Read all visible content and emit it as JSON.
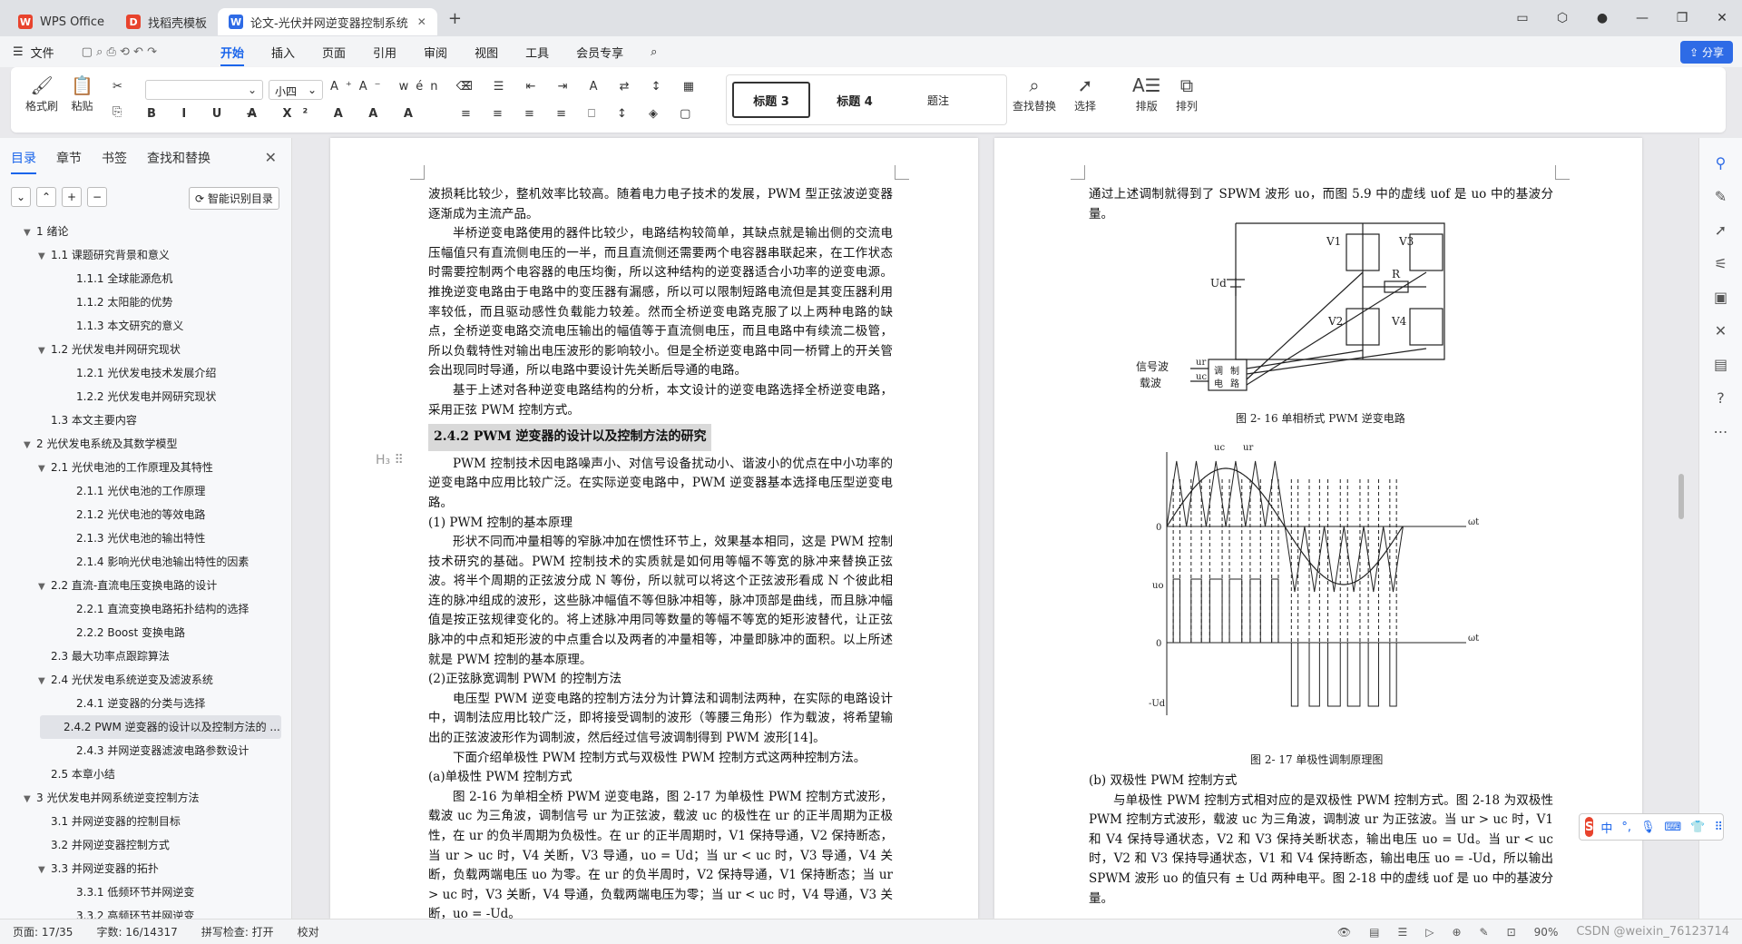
{
  "tabs": [
    {
      "label": "WPS Office",
      "icon": "wps-logo-icon",
      "color": "#e8432d"
    },
    {
      "label": "找稻壳模板",
      "icon": "docer-logo-icon",
      "color": "#e8432d"
    },
    {
      "label": "论文-光伏并网逆变器控制系统",
      "icon": "writer-logo-icon",
      "color": "#2e6be6"
    }
  ],
  "menu": {
    "file": "文件",
    "items": [
      "开始",
      "插入",
      "页面",
      "引用",
      "审阅",
      "视图",
      "工具",
      "会员专享"
    ],
    "active": "开始",
    "share": "分享"
  },
  "ribbon": {
    "format_painter": "格式刷",
    "paste": "粘贴",
    "font_name": "",
    "font_size": "小四",
    "styles": [
      "标题 3",
      "标题 4",
      "题注"
    ],
    "find_replace": "查找替换",
    "select": "选择",
    "typeset": "排版",
    "arrange": "排列"
  },
  "nav": {
    "tabs": [
      "目录",
      "章节",
      "书签",
      "查找和替换"
    ],
    "active_tab": "目录",
    "smart_btn": "智能识别目录",
    "toc": [
      {
        "label": "1  绪论",
        "level": 1,
        "arrow": "▼"
      },
      {
        "label": "1.1 课题研究背景和意义",
        "level": 2,
        "arrow": "▼"
      },
      {
        "label": "1.1.1 全球能源危机",
        "level": 3,
        "arrow": ""
      },
      {
        "label": "1.1.2 太阳能的优势",
        "level": 3,
        "arrow": ""
      },
      {
        "label": "1.1.3 本文研究的意义",
        "level": 3,
        "arrow": ""
      },
      {
        "label": "1.2 光伏发电并网研究现状",
        "level": 2,
        "arrow": "▼"
      },
      {
        "label": "1.2.1 光伏发电技术发展介绍",
        "level": 3,
        "arrow": ""
      },
      {
        "label": "1.2.2 光伏发电并网研究现状",
        "level": 3,
        "arrow": ""
      },
      {
        "label": "1.3 本文主要内容",
        "level": 2,
        "arrow": ""
      },
      {
        "label": "2  光伏发电系统及其数学模型",
        "level": 1,
        "arrow": "▼"
      },
      {
        "label": "2.1 光伏电池的工作原理及其特性",
        "level": 2,
        "arrow": "▼"
      },
      {
        "label": "2.1.1 光伏电池的工作原理",
        "level": 3,
        "arrow": ""
      },
      {
        "label": "2.1.2 光伏电池的等效电路",
        "level": 3,
        "arrow": ""
      },
      {
        "label": "2.1.3 光伏电池的输出特性",
        "level": 3,
        "arrow": ""
      },
      {
        "label": "2.1.4 影响光伏电池输出特性的因素",
        "level": 3,
        "arrow": ""
      },
      {
        "label": "2.2 直流-直流电压变换电路的设计",
        "level": 2,
        "arrow": "▼"
      },
      {
        "label": "2.2.1 直流变换电路拓扑结构的选择",
        "level": 3,
        "arrow": ""
      },
      {
        "label": "2.2.2 Boost 变换电路",
        "level": 3,
        "arrow": ""
      },
      {
        "label": "2.3  最大功率点跟踪算法",
        "level": 2,
        "arrow": ""
      },
      {
        "label": "2.4  光伏发电系统逆变及滤波系统",
        "level": 2,
        "arrow": "▼"
      },
      {
        "label": "2.4.1 逆变器的分类与选择",
        "level": 3,
        "arrow": ""
      },
      {
        "label": "2.4.2 PWM 逆变器的设计以及控制方法的 ...",
        "level": 3,
        "arrow": "",
        "selected": true
      },
      {
        "label": "2.4.3  并网逆变器滤波电路参数设计",
        "level": 3,
        "arrow": ""
      },
      {
        "label": "2.5 本章小结",
        "level": 2,
        "arrow": ""
      },
      {
        "label": "3  光伏发电并网系统逆变控制方法",
        "level": 1,
        "arrow": "▼"
      },
      {
        "label": "3.1  并网逆变器的控制目标",
        "level": 2,
        "arrow": ""
      },
      {
        "label": "3.2    并网逆变器控制方式",
        "level": 2,
        "arrow": ""
      },
      {
        "label": "3.3    并网逆变器的拓扑",
        "level": 2,
        "arrow": "▼"
      },
      {
        "label": "3.3.1    低频环节并网逆变",
        "level": 3,
        "arrow": ""
      },
      {
        "label": "3.3.2    高频环节并网逆变",
        "level": 3,
        "arrow": ""
      }
    ]
  },
  "page1": {
    "paragraphs": [
      {
        "text": "波损耗比较少，整机效率比较高。随着电力电子技术的发展，PWM 型正弦波逆变器逐渐成为主流产品。",
        "indent": false
      },
      {
        "text": "半桥逆变电路使用的器件比较少，电路结构较简单，其缺点就是输出侧的交流电压幅值只有直流侧电压的一半，而且直流侧还需要两个电容器串联起来，在工作状态时需要控制两个电容器的电压均衡，所以这种结构的逆变器适合小功率的逆变电源。推挽逆变电路由于电路中的变压器有漏感，所以可以限制短路电流但是其变压器利用率较低，而且驱动感性负载能力较差。然而全桥逆变电路克服了以上两种电路的缺点，全桥逆变电路交流电压输出的幅值等于直流侧电压，而且电路中有续流二极管，所以负载特性对输出电压波形的影响较小。但是全桥逆变电路中同一桥臂上的开关管会出现同时导通，所以电路中要设计先关断后导通的电路。",
        "indent": true
      },
      {
        "text": "基于上述对各种逆变电路结构的分析，本文设计的逆变电路选择全桥逆变电路，采用正弦 PWM 控制方式。",
        "indent": true
      }
    ],
    "heading": "2.4.2 PWM 逆变器的设计以及控制方法的研究",
    "heading_mark": "H₃ ⠿",
    "paragraphs2": [
      {
        "text": "PWM 控制技术因电路噪声小、对信号设备扰动小、谐波小的优点在中小功率的逆变电路中应用比较广泛。在实际逆变电路中，PWM 逆变器基本选择电压型逆变电路。",
        "indent": true
      },
      {
        "text": "(1)  PWM 控制的基本原理",
        "indent": false
      },
      {
        "text": "形状不同而冲量相等的窄脉冲加在惯性环节上，效果基本相同，这是 PWM 控制技术研究的基础。PWM 控制技术的实质就是如何用等幅不等宽的脉冲来替换正弦波。将半个周期的正弦波分成 N 等份，所以就可以将这个正弦波形看成 N 个彼此相连的脉冲组成的波形，这些脉冲幅值不等但脉冲相等，脉冲顶部是曲线，而且脉冲幅值是按正弦规律变化的。将上述脉冲用同等数量的等幅不等宽的矩形波替代，让正弦脉冲的中点和矩形波的中点重合以及两者的冲量相等，冲量即脉冲的面积。以上所述就是 PWM 控制的基本原理。",
        "indent": true
      },
      {
        "text": "(2)正弦脉宽调制 PWM 的控制方法",
        "indent": false
      },
      {
        "text": "电压型 PWM 逆变电路的控制方法分为计算法和调制法两种，在实际的电路设计中，调制法应用比较广泛，即将接受调制的波形（等腰三角形）作为载波，将希望输出的正弦波波形作为调制波，然后经过信号波调制得到 PWM 波形[14]。",
        "indent": true
      },
      {
        "text": "下面介绍单极性 PWM 控制方式与双极性 PWM 控制方式这两种控制方法。",
        "indent": true
      },
      {
        "text": "(a)单极性 PWM 控制方式",
        "indent": false
      },
      {
        "text": "图 2-16 为单相全桥 PWM 逆变电路，图 2-17 为单极性 PWM 控制方式波形，载波 uc 为三角波，调制信号 ur 为正弦波，载波 uc 的极性在 ur 的正半周期为正极性，在 ur 的负半周期为负极性。在 ur 的正半周期时，V1 保持导通，V2 保持断态，当 ur > uc 时，V4 关断，V3 导通，uo = Ud；当 ur < uc 时，V3 导通，V4 关断，负载两端电压 uo 为零。在 ur 的负半周时，V2 保持导通，V1 保持断态；当 ur > uc 时，V3 关断，V4 导通，负载两端电压为零；当 ur < uc 时，V4 导通，V3 关断，uo = -Ud。",
        "indent": true
      }
    ]
  },
  "page2": {
    "top_text": "通过上述调制就得到了 SPWM 波形 uo，而图 5.9 中的虚线 uof 是 uo 中的基波分量。",
    "circuit": {
      "labels": [
        "V1",
        "V3",
        "V2",
        "V4",
        "R",
        "Ud",
        "信号波",
        "载波",
        "ur",
        "uc",
        "调",
        "制",
        "电",
        "路"
      ]
    },
    "caption1": "图 2- 16  单相桥式 PWM 逆变电路",
    "wave": {
      "labels": [
        "uc",
        "ur",
        "0",
        "ωt",
        "uo",
        "0",
        "ωt",
        "-Ud"
      ]
    },
    "caption2": "图 2- 17  单极性调制原理图",
    "paragraphs": [
      {
        "text": "(b) 双极性 PWM 控制方式",
        "indent": false
      },
      {
        "text": "与单极性 PWM 控制方式相对应的是双极性 PWM 控制方式。图 2-18 为双极性 PWM 控制方式波形，载波 uc 为三角波，调制波 ur 为正弦波。当 ur > uc 时，V1 和 V4 保持导通状态，V2 和 V3 保持关断状态，输出电压 uo = Ud。当 ur < uc 时，V2 和 V3 保持导通状态，V1 和 V4 保持断态，输出电压 uo = -Ud，所以输出 SPWM 波形 uo 的值只有 ± Ud 两种电平。图  2-18 中的虚线 uof 是 uo 中的基波分量。",
        "indent": true
      }
    ]
  },
  "status": {
    "page": "页面: 17/35",
    "words": "字数: 16/14317",
    "spell": "拼写检查: 打开",
    "proof": "校对",
    "zoom": "90%",
    "watermark": "CSDN @weixin_76123714"
  },
  "ime": {
    "items": [
      "中",
      "°,",
      "🎤",
      "⌨",
      "👕",
      "⠿"
    ]
  }
}
